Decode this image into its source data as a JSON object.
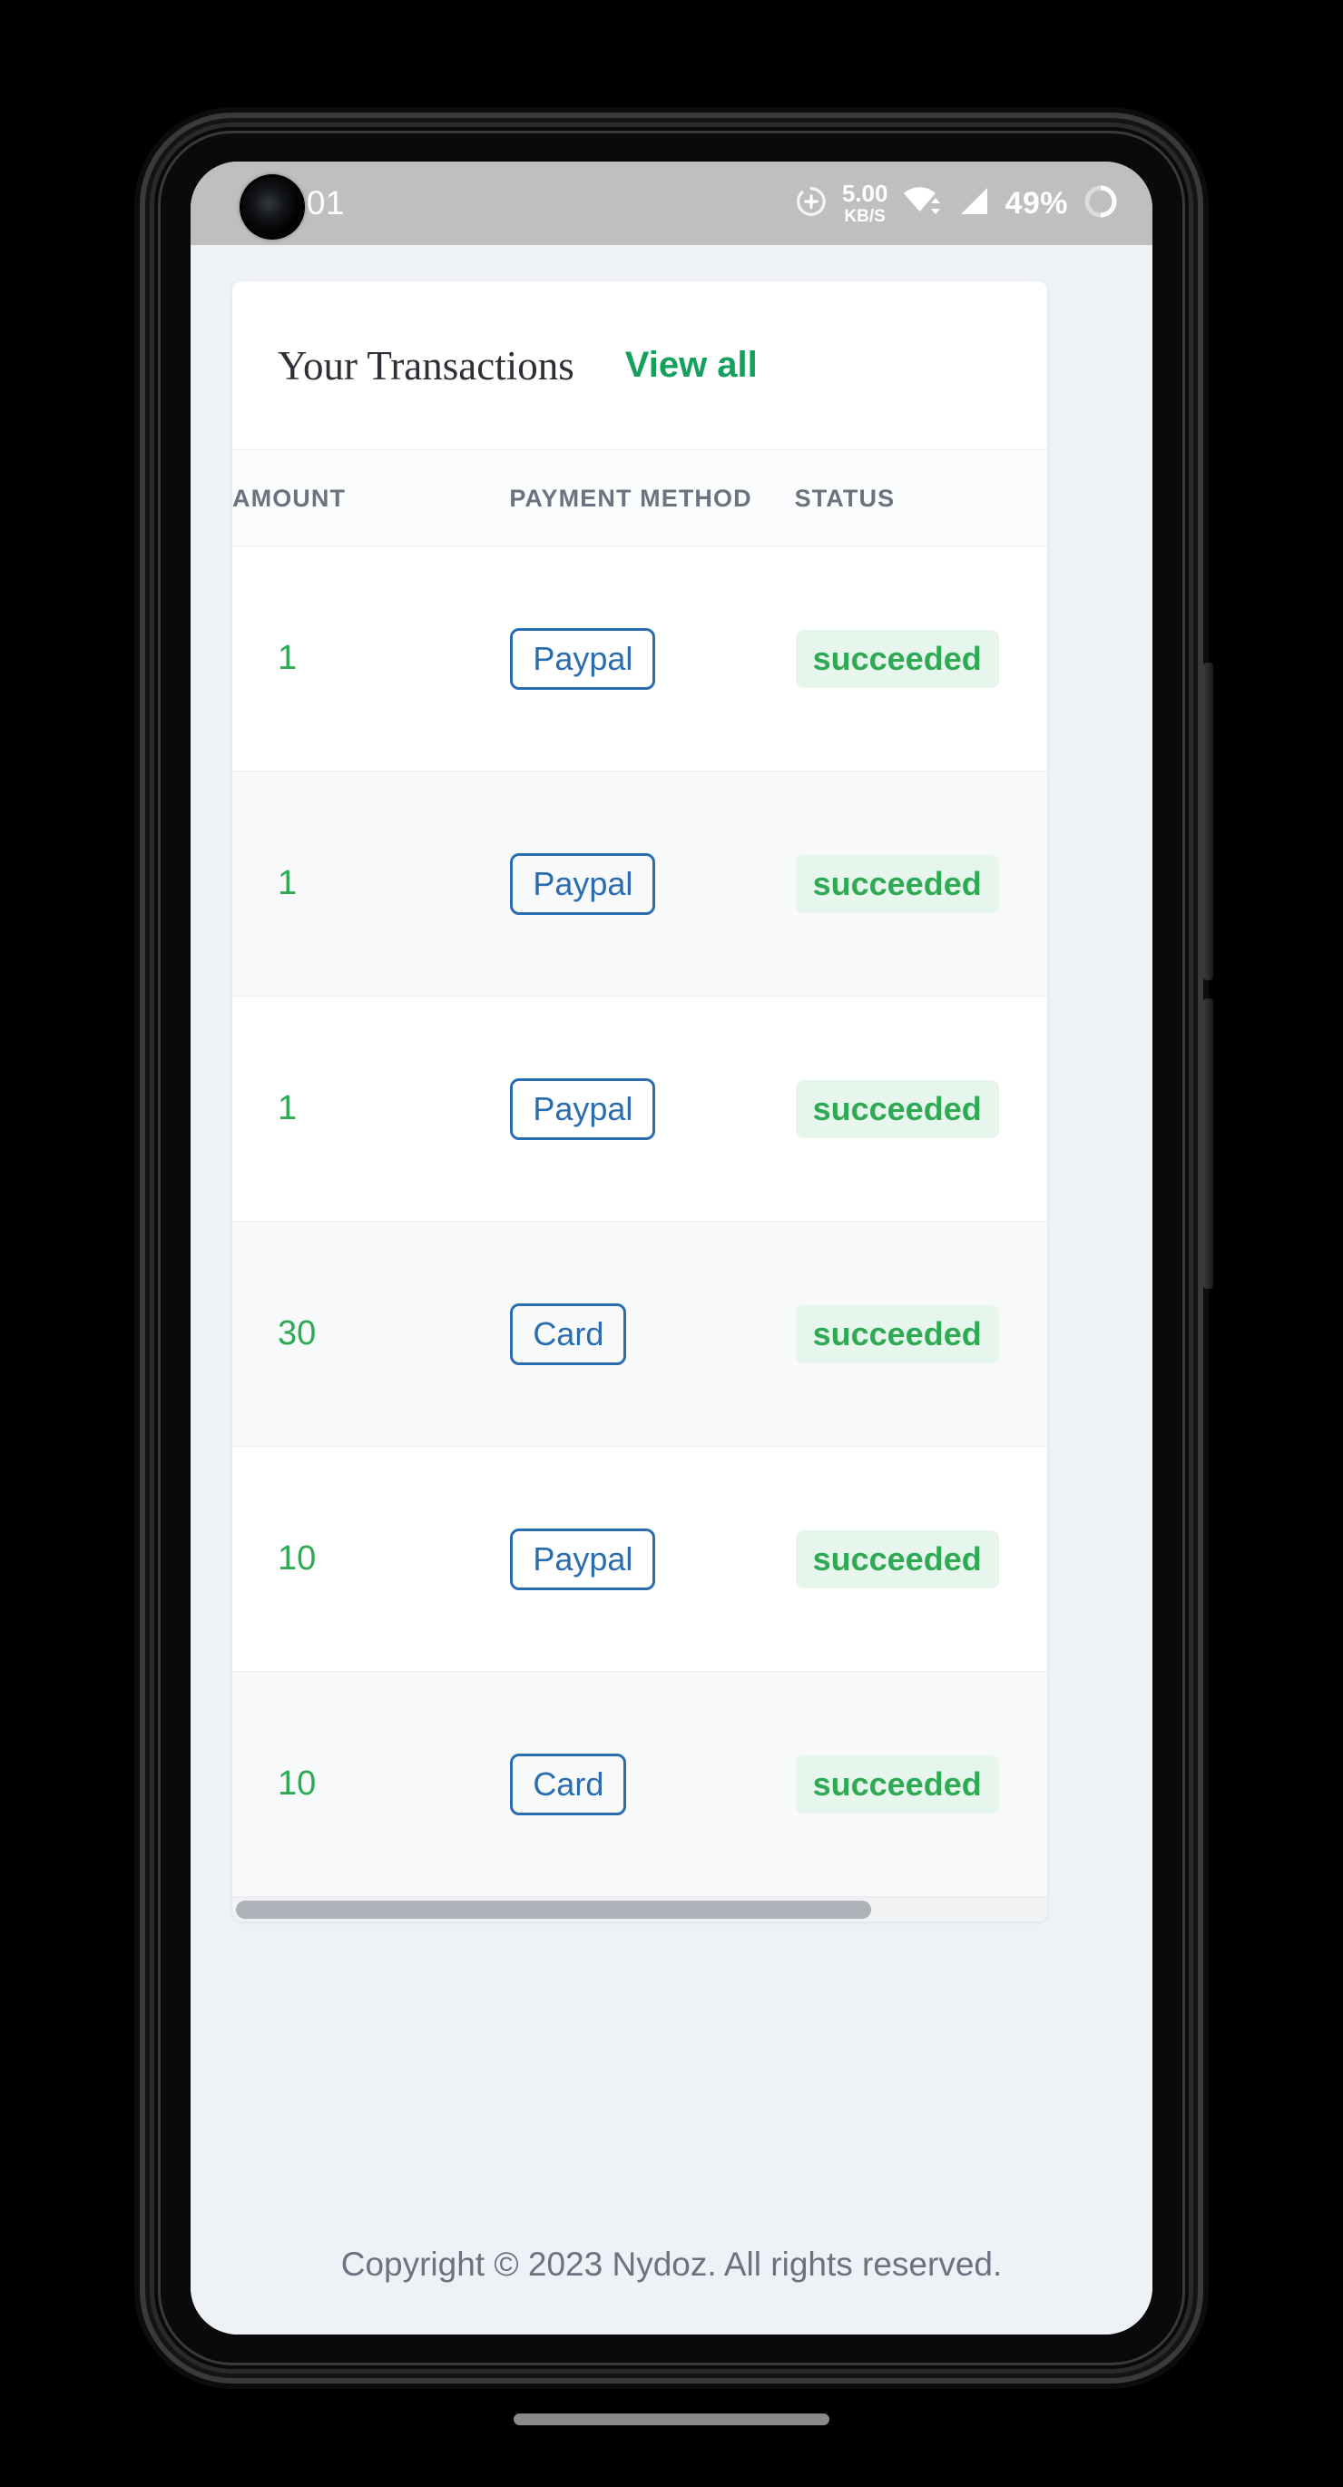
{
  "status_bar": {
    "time": "5:01",
    "network_speed_value": "5.00",
    "network_speed_unit": "KB/S",
    "battery_percent": "49%",
    "icons": [
      "plus-circle-icon",
      "wifi-icon",
      "cellular-signal-icon",
      "battery-ring-icon"
    ]
  },
  "card": {
    "title": "Your Transactions",
    "view_all_label": "View all"
  },
  "table": {
    "columns": [
      "AMOUNT",
      "PAYMENT METHOD",
      "STATUS"
    ],
    "rows": [
      {
        "amount": "1",
        "method": "Paypal",
        "status": "succeeded"
      },
      {
        "amount": "1",
        "method": "Paypal",
        "status": "succeeded"
      },
      {
        "amount": "1",
        "method": "Paypal",
        "status": "succeeded"
      },
      {
        "amount": "30",
        "method": "Card",
        "status": "succeeded"
      },
      {
        "amount": "10",
        "method": "Paypal",
        "status": "succeeded"
      },
      {
        "amount": "10",
        "method": "Card",
        "status": "succeeded"
      }
    ],
    "scroll_thumb_percent": 78
  },
  "footer": {
    "copyright": "Copyright © 2023 Nydoz. All rights reserved."
  },
  "colors": {
    "accent_green": "#15a05e",
    "amount_green": "#2eaa55",
    "status_bg": "#e7f6ec",
    "method_blue": "#2a6cb0",
    "page_bg": "#eef1f6",
    "card_bg": "#ffffff",
    "row_alt_bg": "#f7f9fa",
    "header_text": "#6b7280",
    "status_bar_bg": "#bfbfbf"
  }
}
